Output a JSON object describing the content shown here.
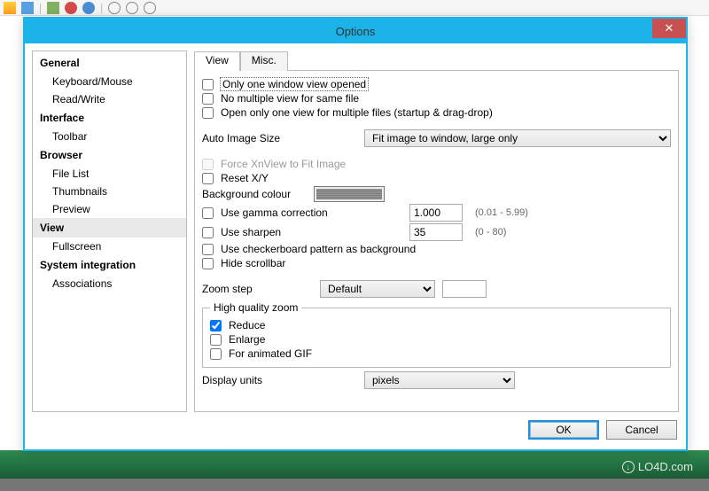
{
  "dialog": {
    "title": "Options",
    "close_glyph": "✕",
    "ok_label": "OK",
    "cancel_label": "Cancel"
  },
  "sidebar": {
    "general": "General",
    "general_items": {
      "keyboard_mouse": "Keyboard/Mouse",
      "read_write": "Read/Write"
    },
    "interface": "Interface",
    "interface_items": {
      "toolbar": "Toolbar"
    },
    "browser": "Browser",
    "browser_items": {
      "file_list": "File List",
      "thumbnails": "Thumbnails",
      "preview": "Preview"
    },
    "view": "View",
    "view_items": {
      "fullscreen": "Fullscreen"
    },
    "system_integration": "System integration",
    "system_items": {
      "associations": "Associations"
    }
  },
  "tabs": {
    "view": "View",
    "misc": "Misc."
  },
  "opts": {
    "only_one_window": "Only one window view opened",
    "no_multiple_view": "No multiple view for same file",
    "open_only_one": "Open only one view for multiple files (startup & drag-drop)",
    "auto_image_size_label": "Auto Image Size",
    "auto_image_size_value": "Fit image to window, large only",
    "force_fit": "Force XnView to Fit Image",
    "reset_xy": "Reset X/Y",
    "background_colour": "Background colour",
    "use_gamma": "Use gamma correction",
    "gamma_value": "1.000",
    "gamma_hint": "(0.01 - 5.99)",
    "use_sharpen": "Use sharpen",
    "sharpen_value": "35",
    "sharpen_hint": "(0 - 80)",
    "use_checkerboard": "Use checkerboard pattern as background",
    "hide_scrollbar": "Hide scrollbar",
    "zoom_step_label": "Zoom step",
    "zoom_step_value": "Default",
    "zoom_custom_value": "",
    "hq_zoom_legend": "High quality zoom",
    "reduce": "Reduce",
    "enlarge": "Enlarge",
    "for_gif": "For animated GIF",
    "display_units_label": "Display units",
    "display_units_value": "pixels"
  },
  "watermark": {
    "text": "LO4D.com",
    "glyph": "↓"
  }
}
